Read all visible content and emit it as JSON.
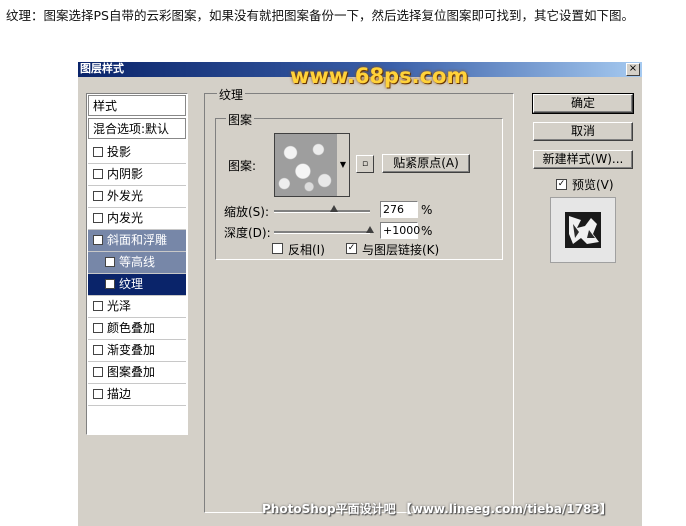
{
  "caption": "纹理：图案选择PS自带的云彩图案，如果没有就把图案备份一下，然后选择复位图案即可找到，其它设置如下图。",
  "dialog": {
    "title": "图层样式",
    "banner": "www.68ps.com",
    "close_label": "×",
    "titlebar_colors": [
      "#0a246a",
      "#a6caf0"
    ]
  },
  "left_panel": {
    "header": "样式",
    "blend_options": "混合选项:默认",
    "items": [
      {
        "label": "投影",
        "checked": false
      },
      {
        "label": "内阴影",
        "checked": false
      },
      {
        "label": "外发光",
        "checked": false
      },
      {
        "label": "内发光",
        "checked": false
      },
      {
        "label": "斜面和浮雕",
        "checked": true
      },
      {
        "label": "等高线",
        "checked": false
      },
      {
        "label": "纹理",
        "checked": true
      },
      {
        "label": "光泽",
        "checked": false
      },
      {
        "label": "颜色叠加",
        "checked": false
      },
      {
        "label": "渐变叠加",
        "checked": false
      },
      {
        "label": "图案叠加",
        "checked": false
      },
      {
        "label": "描边",
        "checked": false
      }
    ]
  },
  "texture": {
    "group_title": "纹理",
    "subgroup_title": "图案",
    "pattern_label": "图案:",
    "snap_button": "贴紧原点(A)",
    "scale_label": "缩放(S):",
    "scale_value": "276",
    "scale_unit": "%",
    "depth_label": "深度(D):",
    "depth_value": "+1000",
    "depth_unit": "%",
    "invert_label": "反相(I)",
    "invert_checked": false,
    "link_label": "与图层链接(K)",
    "link_checked": true
  },
  "buttons": {
    "ok": "确定",
    "cancel": "取消",
    "new_style": "新建样式(W)...",
    "preview_label": "预览(V)",
    "preview_checked": true
  },
  "watermark": "PhotoShop平面设计吧 【www.lineeg.com/tieba/1783】",
  "check_mark": "✓"
}
